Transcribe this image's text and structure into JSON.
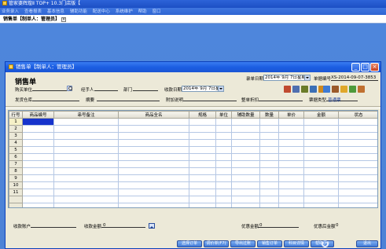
{
  "app": {
    "title": "管家婆辉煌Ⅱ TOP+ 10.3门店版【",
    "menu": [
      "业务录入",
      "查看报表",
      "基本信息",
      "辅助功能",
      "配送中心",
      "系统维护",
      "帮助",
      "窗口"
    ]
  },
  "doc_tab": {
    "label": "销售单【制单人：管理员】",
    "close": "×"
  },
  "window": {
    "title": "销售单【制单人：管理员】",
    "controls": [
      "_",
      "□",
      "×"
    ]
  },
  "form": {
    "title": "销售单",
    "entry_date_label": "录单日期",
    "entry_date": "2014年 9月 7日星期",
    "doc_no_label": "单据编号",
    "doc_no": "XS-2014-09-07-3853",
    "buyer_label": "购买单位",
    "handler_label": "经手人",
    "dept_label": "部门",
    "receipt_date_label": "收款日期",
    "receipt_date": "2014年 9月 7日星期",
    "warehouse_label": "发货仓库",
    "summary_label": "摘要",
    "addon_label": "附加说明",
    "whole_discount_label": "整单折扣",
    "print_style_label": "票据类型",
    "print_style": "普通票"
  },
  "grid": {
    "columns": [
      "行号",
      "商品编号",
      "串号备注",
      "商品全名",
      "规格",
      "单位",
      "辅助数量",
      "数量",
      "单价",
      "金额",
      "状态"
    ],
    "rows": [
      "1",
      "2",
      "3",
      "4",
      "5",
      "6",
      "7",
      "8",
      "9",
      "10",
      "11"
    ],
    "total_label": "合计"
  },
  "footer": {
    "account_label": "收款账户",
    "amount_label": "收款金额",
    "amount_value": "0",
    "discount_label": "优惠金额",
    "discount_value": "0",
    "after_discount_label": "优惠后金额",
    "after_discount_value": "0",
    "buttons": [
      "选择订单",
      "调价单(F7)",
      "导出过账",
      "销售订单",
      "科目详情",
      "帮助(H)",
      "退出"
    ]
  },
  "colors": {
    "titlebar": "#1c5ee2",
    "selected_cell": "#1633cc"
  }
}
